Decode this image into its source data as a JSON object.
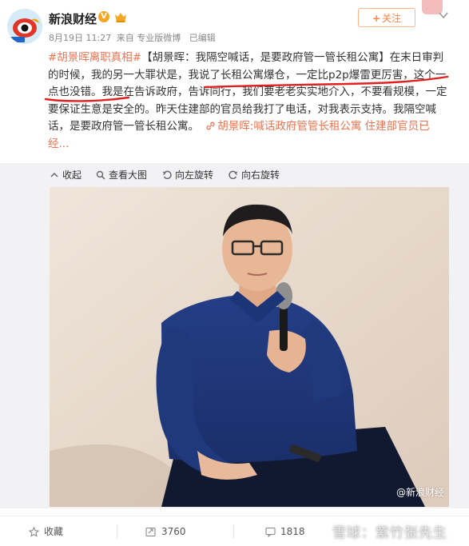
{
  "post": {
    "author": "新浪财经",
    "verified_badge": "V",
    "date": "8月19日 11:27",
    "source": "来自 专业版微博",
    "edited": "已编辑",
    "follow_label": "关注",
    "body": {
      "topic": "#胡景晖离职真相#",
      "seg1": "【胡景晖：我隔空喊话，是要政府管一管长租公寓】在末日审判的时候，我的另一大罪状是，",
      "seg2": "我说了长租公寓爆仓，一定比p2p爆雷更厉害，这个一点也没错",
      "seg3": "。我是在告诉政府，告诉同行，我们要老老实实地介入，不要看规模，一定要保证生意是安全的。昨天住建部的官员给我打了电话，对我表示支持。我隔空喊话，是要政府管一管长租公寓。",
      "link": "胡景晖:喊话政府管管长租公寓 住建部官员已经...",
      "link_icon": "link-icon"
    }
  },
  "toolbar": {
    "collapse": "收起",
    "view_large": "查看大图",
    "rotate_left": "向左旋转",
    "rotate_right": "向右旋转"
  },
  "image": {
    "watermark": "@新浪财经"
  },
  "actions": {
    "favorite": "收藏",
    "repost": "3760",
    "comment": "1818"
  },
  "overlay_watermark": "雪球：紫竹张先生",
  "colors": {
    "accent": "#eb7350",
    "follow": "#ff8140",
    "underline": "#e02020",
    "toolbar_bg": "#f2f2f5"
  }
}
